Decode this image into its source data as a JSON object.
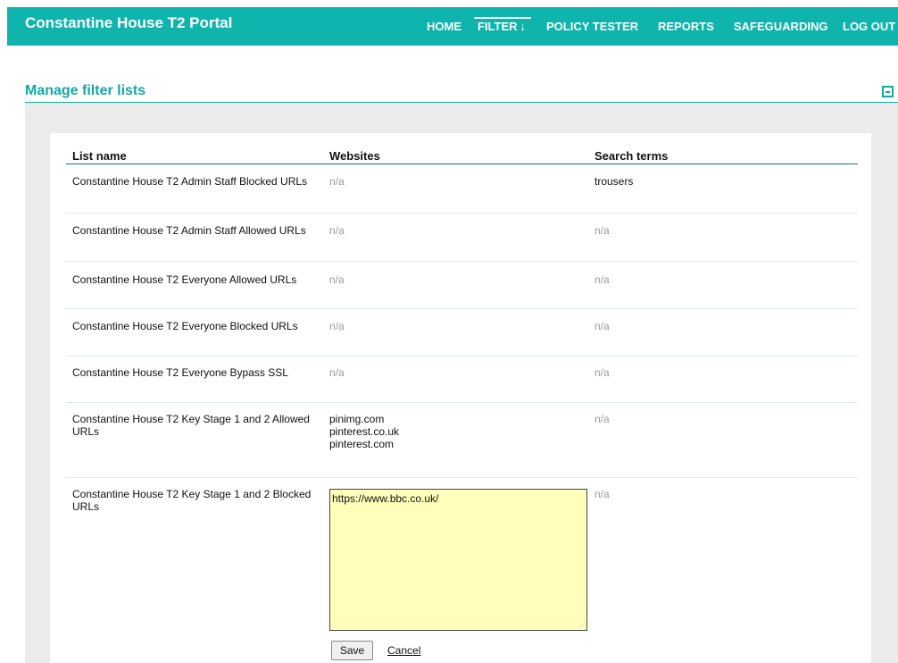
{
  "header": {
    "brand": "Constantine House T2 Portal",
    "nav": [
      {
        "label": "HOME"
      },
      {
        "label": "FILTER",
        "indicator": "↓",
        "active": true
      },
      {
        "label": "POLICY TESTER"
      },
      {
        "label": "REPORTS"
      },
      {
        "label": "SAFEGUARDING"
      },
      {
        "label": "LOG OUT"
      }
    ]
  },
  "section": {
    "title": "Manage filter lists",
    "collapse_icon": "minus-box-icon"
  },
  "table": {
    "columns": [
      "List name",
      "Websites",
      "Search terms"
    ],
    "rows": [
      {
        "name": "Constantine House T2 Admin Staff Blocked URLs",
        "websites": "n/a",
        "search_terms": "trousers"
      },
      {
        "name": "Constantine House T2 Admin Staff Allowed URLs",
        "websites": "n/a",
        "search_terms": "n/a"
      },
      {
        "name": "Constantine House T2 Everyone Allowed URLs",
        "websites": "n/a",
        "search_terms": "n/a"
      },
      {
        "name": "Constantine House T2 Everyone Blocked URLs",
        "websites": "n/a",
        "search_terms": "n/a"
      },
      {
        "name": "Constantine House T2 Everyone Bypass SSL",
        "websites": "n/a",
        "search_terms": "n/a"
      },
      {
        "name": "Constantine House T2 Key Stage 1 and 2 Allowed URLs",
        "websites": [
          "pinimg.com",
          "pinterest.co.uk",
          "pinterest.com"
        ],
        "search_terms": "n/a"
      },
      {
        "name": "Constantine House T2 Key Stage 1 and 2 Blocked URLs",
        "websites_editor_value": "https://www.bbc.co.uk/",
        "search_terms": "n/a"
      }
    ]
  },
  "editor": {
    "save_label": "Save",
    "cancel_label": "Cancel"
  },
  "colors": {
    "accent": "#0fb4ac",
    "title_teal": "#13a9a2",
    "panel_grey": "#ebebeb",
    "editor_bg": "#ffffbb",
    "muted_text": "#999999"
  }
}
